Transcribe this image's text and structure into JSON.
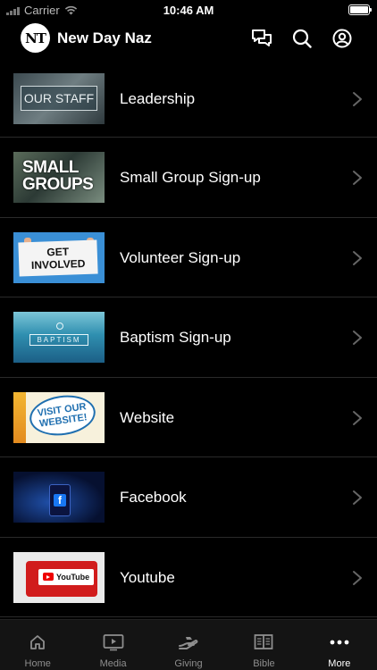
{
  "status_bar": {
    "carrier": "Carrier",
    "time": "10:46 AM"
  },
  "header": {
    "logo_text": "NT",
    "title": "New Day Naz",
    "icons": [
      "chat-icon",
      "search-icon",
      "account-icon"
    ]
  },
  "list": {
    "items": [
      {
        "label": "Leadership",
        "thumb_text": "OUR STAFF"
      },
      {
        "label": "Small Group Sign-up",
        "thumb_text": [
          "SMALL",
          "GROUPS"
        ]
      },
      {
        "label": "Volunteer Sign-up",
        "thumb_text": [
          "GET",
          "INVOLVED"
        ]
      },
      {
        "label": "Baptism Sign-up",
        "thumb_text": "BAPTISM"
      },
      {
        "label": "Website",
        "thumb_text": [
          "VISIT OUR",
          "WEBSITE!"
        ]
      },
      {
        "label": "Facebook",
        "thumb_text": "f"
      },
      {
        "label": "Youtube",
        "thumb_text": "YouTube"
      }
    ]
  },
  "tab_bar": {
    "tabs": [
      {
        "label": "Home",
        "icon": "home-icon",
        "active": false
      },
      {
        "label": "Media",
        "icon": "media-icon",
        "active": false
      },
      {
        "label": "Giving",
        "icon": "giving-icon",
        "active": false
      },
      {
        "label": "Bible",
        "icon": "bible-icon",
        "active": false
      },
      {
        "label": "More",
        "icon": "more-icon",
        "active": true
      }
    ]
  },
  "colors": {
    "background": "#000000",
    "divider": "#2a2a2a",
    "tab_inactive": "#8e8e8e",
    "tab_active": "#ffffff"
  }
}
